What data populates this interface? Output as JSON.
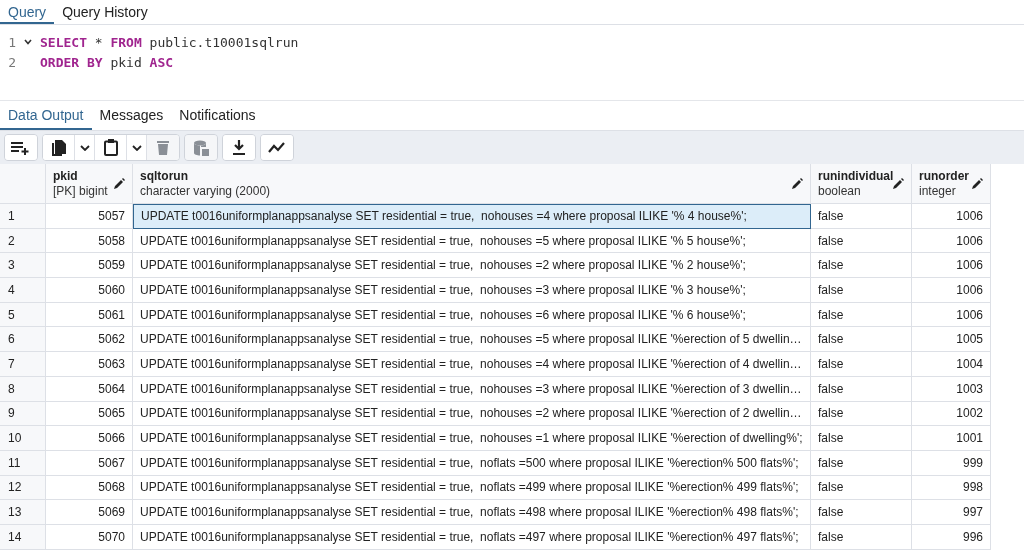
{
  "editor_tabs": [
    {
      "label": "Query",
      "selected": true
    },
    {
      "label": "Query History",
      "selected": false
    }
  ],
  "editor": {
    "lines": [
      {
        "number": "1",
        "foldable": true,
        "tokens": [
          {
            "kind": "keyword",
            "text": "SELECT"
          },
          {
            "kind": "plain",
            "text": " * "
          },
          {
            "kind": "keyword",
            "text": "FROM"
          },
          {
            "kind": "plain",
            "text": " public.t10001sqlrun"
          }
        ]
      },
      {
        "number": "2",
        "foldable": false,
        "tokens": [
          {
            "kind": "keyword",
            "text": "ORDER BY"
          },
          {
            "kind": "plain",
            "text": " pkid "
          },
          {
            "kind": "keyword",
            "text": "ASC"
          }
        ]
      }
    ]
  },
  "output_tabs": [
    {
      "label": "Data Output",
      "selected": true
    },
    {
      "label": "Messages",
      "selected": false
    },
    {
      "label": "Notifications",
      "selected": false
    }
  ],
  "toolbar": [
    [
      {
        "kind": "add-row",
        "disabled": false
      }
    ],
    [
      {
        "kind": "copy",
        "disabled": false
      },
      {
        "kind": "dropdown",
        "disabled": false
      },
      {
        "kind": "paste",
        "disabled": false
      },
      {
        "kind": "dropdown",
        "disabled": false
      },
      {
        "kind": "delete",
        "disabled": true
      }
    ],
    [
      {
        "kind": "save-data",
        "disabled": true
      }
    ],
    [
      {
        "kind": "download",
        "disabled": false
      }
    ],
    [
      {
        "kind": "graph",
        "disabled": false
      }
    ]
  ],
  "table": {
    "columns": [
      {
        "name": "pkid",
        "type": "[PK] bigint"
      },
      {
        "name": "sqltorun",
        "type": "character varying (2000)"
      },
      {
        "name": "runindividual",
        "type": "boolean"
      },
      {
        "name": "runorder",
        "type": "integer"
      }
    ],
    "rows": [
      {
        "number": "1",
        "selected": true,
        "cells": [
          "5057",
          "UPDATE t0016uniformplanappsanalyse SET residential = true,  nohouses =4 where proposal ILIKE '% 4 house%';",
          "false",
          "1006"
        ]
      },
      {
        "number": "2",
        "selected": false,
        "cells": [
          "5058",
          "UPDATE t0016uniformplanappsanalyse SET residential = true,  nohouses =5 where proposal ILIKE '% 5 house%';",
          "false",
          "1006"
        ]
      },
      {
        "number": "3",
        "selected": false,
        "cells": [
          "5059",
          "UPDATE t0016uniformplanappsanalyse SET residential = true,  nohouses =2 where proposal ILIKE '% 2 house%';",
          "false",
          "1006"
        ]
      },
      {
        "number": "4",
        "selected": false,
        "cells": [
          "5060",
          "UPDATE t0016uniformplanappsanalyse SET residential = true,  nohouses =3 where proposal ILIKE '% 3 house%';",
          "false",
          "1006"
        ]
      },
      {
        "number": "5",
        "selected": false,
        "cells": [
          "5061",
          "UPDATE t0016uniformplanappsanalyse SET residential = true,  nohouses =6 where proposal ILIKE '% 6 house%';",
          "false",
          "1006"
        ]
      },
      {
        "number": "6",
        "selected": false,
        "cells": [
          "5062",
          "UPDATE t0016uniformplanappsanalyse SET residential = true,  nohouses =5 where proposal ILIKE '%erection of 5 dwellin…",
          "false",
          "1005"
        ]
      },
      {
        "number": "7",
        "selected": false,
        "cells": [
          "5063",
          "UPDATE t0016uniformplanappsanalyse SET residential = true,  nohouses =4 where proposal ILIKE '%erection of 4 dwellin…",
          "false",
          "1004"
        ]
      },
      {
        "number": "8",
        "selected": false,
        "cells": [
          "5064",
          "UPDATE t0016uniformplanappsanalyse SET residential = true,  nohouses =3 where proposal ILIKE '%erection of 3 dwellin…",
          "false",
          "1003"
        ]
      },
      {
        "number": "9",
        "selected": false,
        "cells": [
          "5065",
          "UPDATE t0016uniformplanappsanalyse SET residential = true,  nohouses =2 where proposal ILIKE '%erection of 2 dwellin…",
          "false",
          "1002"
        ]
      },
      {
        "number": "10",
        "selected": false,
        "cells": [
          "5066",
          "UPDATE t0016uniformplanappsanalyse SET residential = true,  nohouses =1 where proposal ILIKE '%erection of dwelling%';",
          "false",
          "1001"
        ]
      },
      {
        "number": "11",
        "selected": false,
        "cells": [
          "5067",
          "UPDATE t0016uniformplanappsanalyse SET residential = true,  noflats =500 where proposal ILIKE '%erection% 500 flats%';",
          "false",
          "999"
        ]
      },
      {
        "number": "12",
        "selected": false,
        "cells": [
          "5068",
          "UPDATE t0016uniformplanappsanalyse SET residential = true,  noflats =499 where proposal ILIKE '%erection% 499 flats%';",
          "false",
          "998"
        ]
      },
      {
        "number": "13",
        "selected": false,
        "cells": [
          "5069",
          "UPDATE t0016uniformplanappsanalyse SET residential = true,  noflats =498 where proposal ILIKE '%erection% 498 flats%';",
          "false",
          "997"
        ]
      },
      {
        "number": "14",
        "selected": false,
        "cells": [
          "5070",
          "UPDATE t0016uniformplanappsanalyse SET residential = true,  noflats =497 where proposal ILIKE '%erection% 497 flats%';",
          "false",
          "996"
        ]
      }
    ]
  }
}
